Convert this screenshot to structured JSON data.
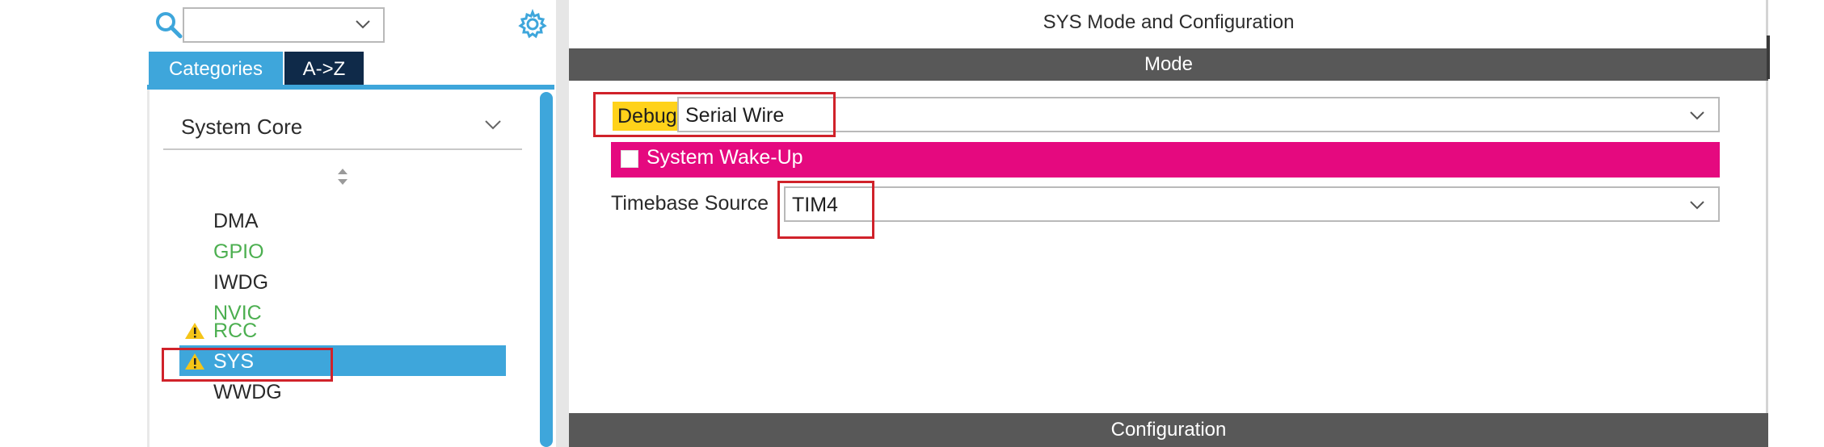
{
  "sidebar": {
    "search": {
      "value": ""
    },
    "tabs": [
      {
        "label": "Categories",
        "active": true
      },
      {
        "label": "A->Z",
        "active": false
      }
    ],
    "category": "System Core",
    "items": [
      {
        "label": "DMA",
        "color": "#2a2a2a",
        "warning": false,
        "selected": false
      },
      {
        "label": "GPIO",
        "color": "#4caf50",
        "warning": false,
        "selected": false
      },
      {
        "label": "IWDG",
        "color": "#2a2a2a",
        "warning": false,
        "selected": false
      },
      {
        "label": "NVIC",
        "color": "#4caf50",
        "warning": false,
        "selected": false
      },
      {
        "label": "RCC",
        "color": "#4caf50",
        "warning": true,
        "selected": false
      },
      {
        "label": "SYS",
        "color": "#ffffff",
        "warning": true,
        "selected": true
      },
      {
        "label": "WWDG",
        "color": "#2a2a2a",
        "warning": false,
        "selected": false
      }
    ],
    "accent_color": "#3ea6db",
    "dark_tab_color": "#0f2a49"
  },
  "main": {
    "title": "SYS Mode and Configuration",
    "mode_header": "Mode",
    "debug": {
      "label": "Debug",
      "value": "Serial Wire"
    },
    "system_wakeup": {
      "label": "System Wake-Up",
      "checked": false
    },
    "timebase": {
      "label": "Timebase Source",
      "value": "TIM4"
    },
    "config_header": "Configuration",
    "colors": {
      "header_bar": "#585858",
      "wakeup_bar": "#e5097f",
      "debug_highlight": "#ffd21a",
      "annotation_box": "#d0222a"
    }
  }
}
